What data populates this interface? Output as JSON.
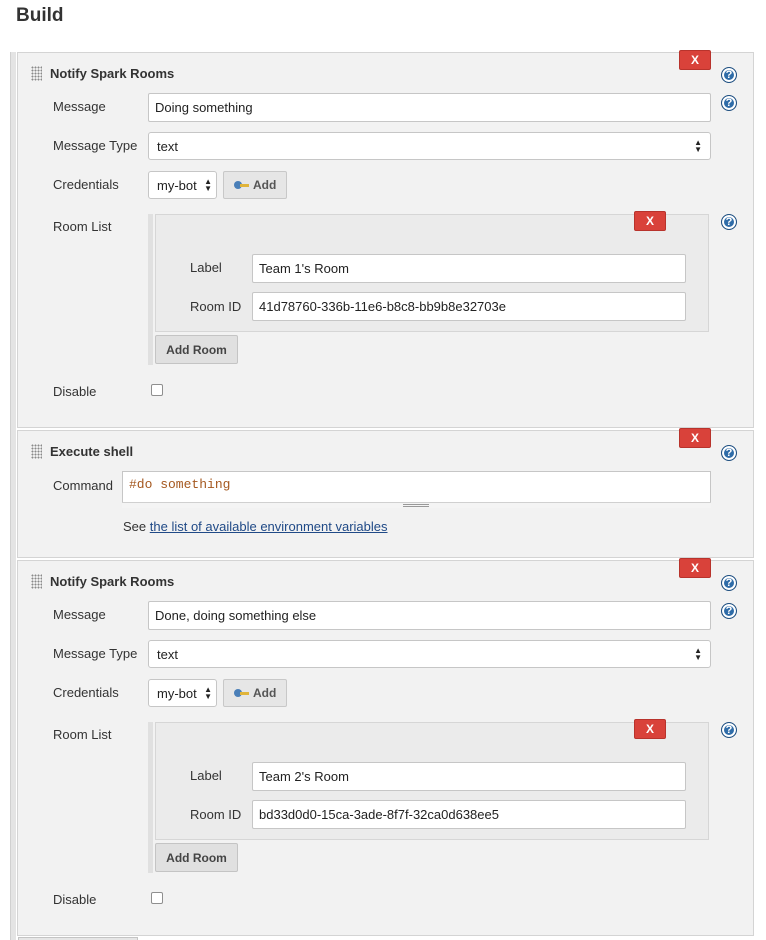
{
  "page": {
    "title": "Build"
  },
  "step1": {
    "title": "Notify Spark Rooms",
    "delete_label": "X",
    "help_label": "?",
    "message_label": "Message",
    "message_value": "Doing something",
    "message_type_label": "Message Type",
    "message_type_value": "text",
    "credentials_label": "Credentials",
    "credentials_value": "my-bot",
    "add_label": "Add",
    "room_list_label": "Room List",
    "room": {
      "delete_label": "X",
      "label_label": "Label",
      "label_value": "Team 1's Room",
      "room_id_label": "Room ID",
      "room_id_value": "41d78760-336b-11e6-b8c8-bb9b8e32703e"
    },
    "add_room_label": "Add Room",
    "disable_label": "Disable",
    "disable_checked": false
  },
  "step2": {
    "title": "Execute shell",
    "delete_label": "X",
    "help_label": "?",
    "command_label": "Command",
    "command_value": "#do something",
    "see_prefix": "See",
    "env_link": "the list of available environment variables"
  },
  "step3": {
    "title": "Notify Spark Rooms",
    "delete_label": "X",
    "help_label": "?",
    "message_label": "Message",
    "message_value": "Done, doing something else",
    "message_type_label": "Message Type",
    "message_type_value": "text",
    "credentials_label": "Credentials",
    "credentials_value": "my-bot",
    "add_label": "Add",
    "room_list_label": "Room List",
    "room": {
      "delete_label": "X",
      "label_label": "Label",
      "label_value": "Team 2's Room",
      "room_id_label": "Room ID",
      "room_id_value": "bd33d0d0-15ca-3ade-8f7f-32ca0d638ee5"
    },
    "add_room_label": "Add Room",
    "disable_label": "Disable",
    "disable_checked": false
  },
  "colors": {
    "delete_button": "#d9423a",
    "help_icon": "#2f6ca8",
    "link": "#204a87",
    "command_text": "#a5581f"
  },
  "icons": {
    "drag_handle": "drag-handle-icon",
    "help": "help-icon",
    "key": "key-icon",
    "select_arrows": "updown-arrows-icon"
  }
}
